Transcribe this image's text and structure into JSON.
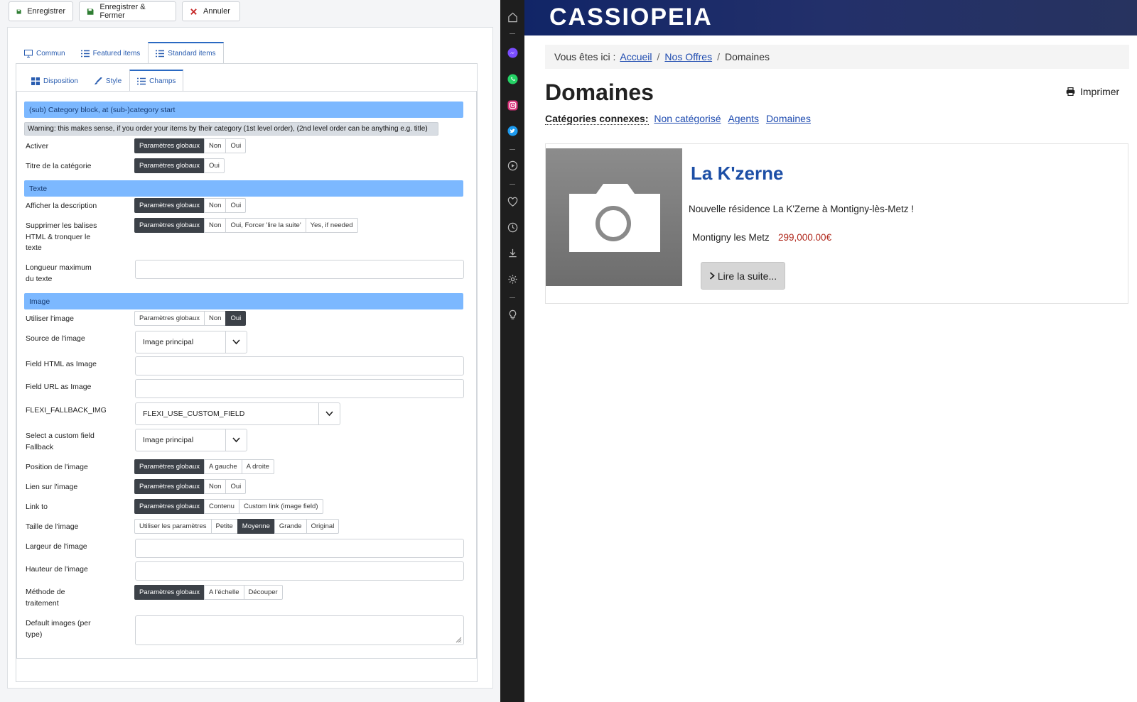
{
  "toolbar": {
    "save": "Enregistrer",
    "save_close": "Enregistrer & Fermer",
    "cancel": "Annuler"
  },
  "tabs_main": [
    "Commun",
    "Featured items",
    "Standard items"
  ],
  "tabs_sub": [
    "Disposition",
    "Style",
    "Champs"
  ],
  "form": {
    "section_category": "(sub) Category block, at (sub-)category start",
    "warning": "Warning: this makes sense, if you order your items by their category (1st level order), (2nd level order can be anything e.g. title)",
    "activer": {
      "label": "Activer",
      "options": [
        "Paramètres globaux",
        "Non",
        "Oui"
      ],
      "selected": "Paramètres globaux"
    },
    "titre_categorie": {
      "label": "Titre de la catégorie",
      "options": [
        "Paramètres globaux",
        "Oui"
      ],
      "selected": "Paramètres globaux"
    },
    "section_texte": "Texte",
    "afficher_description": {
      "label": "Afficher la description",
      "options": [
        "Paramètres globaux",
        "Non",
        "Oui"
      ],
      "selected": "Paramètres globaux"
    },
    "supprimer_balises": {
      "label_lines": [
        "Supprimer les balises",
        "HTML & tronquer le",
        "texte"
      ],
      "options": [
        "Paramètres globaux",
        "Non",
        "Oui, Forcer 'lire la suite'",
        "Yes, if needed"
      ],
      "selected": "Paramètres globaux"
    },
    "longueur_max": {
      "label_lines": [
        "Longueur maximum",
        "du texte"
      ],
      "value": ""
    },
    "section_image": "Image",
    "utiliser_image": {
      "label": "Utiliser l'image",
      "options": [
        "Paramètres globaux",
        "Non",
        "Oui"
      ],
      "selected": "Oui"
    },
    "source_image": {
      "label": "Source de l'image",
      "value": "Image principal"
    },
    "field_html_image": {
      "label": "Field HTML as Image",
      "value": ""
    },
    "field_url_image": {
      "label": "Field URL as Image",
      "value": ""
    },
    "fallback_img": {
      "label": "FLEXI_FALLBACK_IMG",
      "value": "FLEXI_USE_CUSTOM_FIELD"
    },
    "custom_fallback": {
      "label_lines": [
        "Select a custom field",
        "Fallback"
      ],
      "value": "Image principal"
    },
    "position_image": {
      "label": "Position de l'image",
      "options": [
        "Paramètres globaux",
        "A gauche",
        "A droite"
      ],
      "selected": "Paramètres globaux"
    },
    "lien_image": {
      "label": "Lien sur l'image",
      "options": [
        "Paramètres globaux",
        "Non",
        "Oui"
      ],
      "selected": "Paramètres globaux"
    },
    "link_to": {
      "label": "Link to",
      "options": [
        "Paramètres globaux",
        "Contenu",
        "Custom link (image field)"
      ],
      "selected": "Paramètres globaux"
    },
    "taille_image": {
      "label": "Taille de l'image",
      "options": [
        "Utiliser les paramètres",
        "Petite",
        "Moyenne",
        "Grande",
        "Original"
      ],
      "selected": "Moyenne"
    },
    "largeur_image": {
      "label": "Largeur de l'image",
      "value": ""
    },
    "hauteur_image": {
      "label": "Hauteur de l'image",
      "value": ""
    },
    "methode": {
      "label_lines": [
        "Méthode de",
        "traitement"
      ],
      "options": [
        "Paramètres globaux",
        "A l'échelle",
        "Découper"
      ],
      "selected": "Paramètres globaux"
    },
    "default_images": {
      "label_lines": [
        "Default images (per",
        "type)"
      ],
      "value": ""
    }
  },
  "site": {
    "brand": "CASSIOPEIA",
    "breadcrumb": {
      "prefix": "Vous êtes ici :",
      "links": [
        "Accueil",
        "Nos Offres"
      ],
      "current": "Domaines"
    },
    "page_title": "Domaines",
    "print": "Imprimer",
    "related_label": "Catégories connexes:",
    "related": [
      "Non catégorisé",
      "Agents",
      "Domaines"
    ],
    "item": {
      "title": "La K'zerne",
      "description": "Nouvelle résidence La K'Zerne à Montigny-lès-Metz !",
      "location": "Montigny les Metz",
      "price": "299,000.00€",
      "read_more": "Lire la suite..."
    }
  },
  "sidebar_icons": [
    "home-icon",
    "messenger-icon",
    "whatsapp-icon",
    "instagram-icon",
    "twitter-icon",
    "play-icon",
    "heart-icon",
    "clock-icon",
    "download-icon",
    "settings-icon",
    "lightbulb-icon"
  ],
  "colors": {
    "section_blue": "#7cb8ff",
    "header_navy": "#112567",
    "link_blue": "#1e4bb0",
    "price_red": "#b0281c",
    "segment_active": "#3c4148"
  }
}
